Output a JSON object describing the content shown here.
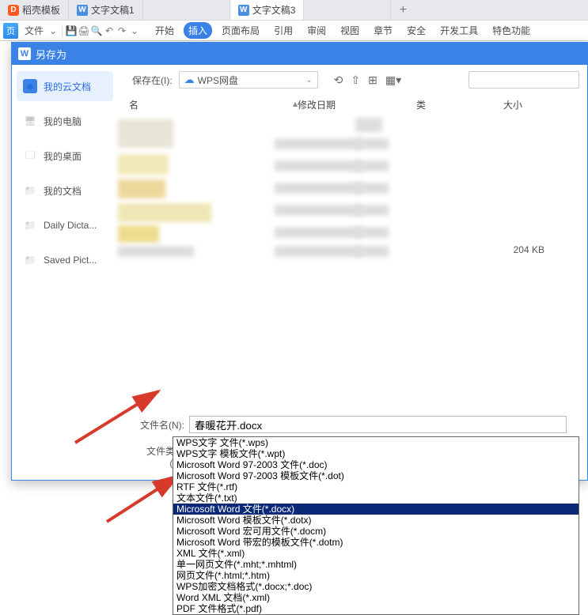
{
  "tabs": [
    {
      "label": "稻壳模板",
      "type": "d"
    },
    {
      "label": "文字文稿1",
      "type": "w"
    },
    {
      "label": "文字文稿3",
      "type": "w",
      "active": true
    }
  ],
  "toolbar": {
    "page_label": "页",
    "file_label": "文件",
    "menus": [
      "开始",
      "插入",
      "页面布局",
      "引用",
      "审阅",
      "视图",
      "章节",
      "安全",
      "开发工具",
      "特色功能"
    ],
    "active_menu": 1
  },
  "dialog": {
    "title": "另存为",
    "location_label": "保存在(I):",
    "location_value": "WPS网盘",
    "columns": {
      "name": "名",
      "date": "修改日期",
      "type": "类",
      "size": "大小"
    },
    "size_sample": "204 KB",
    "filename_label": "文件名(N):",
    "filename_value": "春暖花开.docx",
    "filetype_label": "文件类型(T):",
    "filetype_value": "Microsoft Word 文件(*.docx)"
  },
  "sidebar": [
    {
      "label": "我的云文档",
      "icon": "cube",
      "active": true
    },
    {
      "label": "我的电脑",
      "icon": "monitor"
    },
    {
      "label": "我的桌面",
      "icon": "desktop"
    },
    {
      "label": "我的文档",
      "icon": "folder"
    },
    {
      "label": "Daily Dicta...",
      "icon": "folder"
    },
    {
      "label": "Saved Pict...",
      "icon": "folder"
    }
  ],
  "filetype_options": [
    "WPS文字 文件(*.wps)",
    "WPS文字 模板文件(*.wpt)",
    "Microsoft Word 97-2003 文件(*.doc)",
    "Microsoft Word 97-2003 模板文件(*.dot)",
    "RTF 文件(*.rtf)",
    "文本文件(*.txt)",
    "Microsoft Word 文件(*.docx)",
    "Microsoft Word 模板文件(*.dotx)",
    "Microsoft Word 宏可用文件(*.docm)",
    "Microsoft Word 带宏的模板文件(*.dotm)",
    "XML 文件(*.xml)",
    "单一网页文件(*.mht;*.mhtml)",
    "网页文件(*.html;*.htm)",
    "WPS加密文档格式(*.docx;*.doc)",
    "Word XML 文档(*.xml)",
    "PDF 文件格式(*.pdf)"
  ],
  "filetype_selected_index": 6
}
